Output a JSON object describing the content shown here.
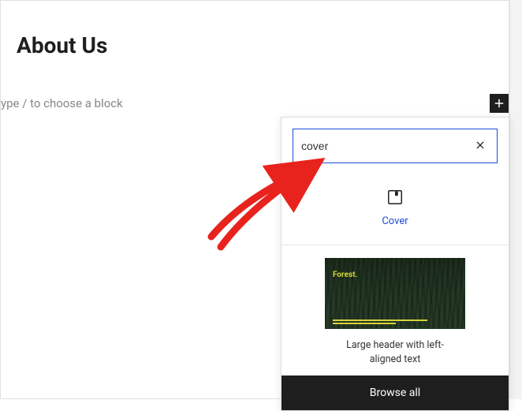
{
  "page": {
    "title": "About Us",
    "placeholder": "ype / to choose a block"
  },
  "inserter": {
    "search_value": "cover",
    "block": {
      "label": "Cover"
    },
    "pattern": {
      "thumb_title": "Forest.",
      "label": "Large header with left-aligned text"
    },
    "browse_all": "Browse all"
  }
}
